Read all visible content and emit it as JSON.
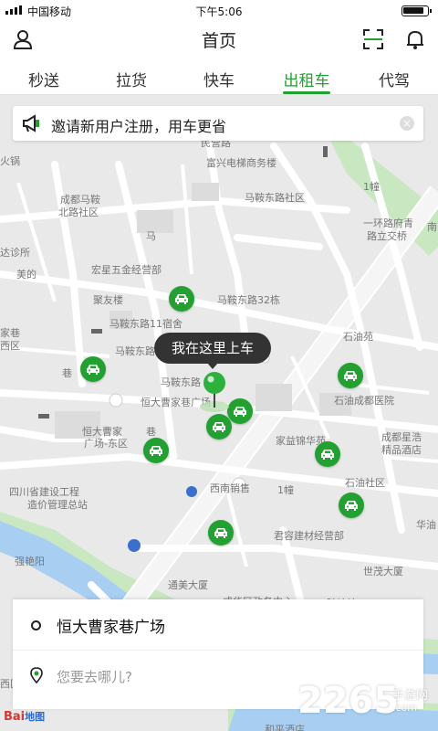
{
  "status_bar": {
    "carrier": "中国移动",
    "time": "下午5:06"
  },
  "header": {
    "title": "首页",
    "profile_icon": "person-icon",
    "scan_icon": "scan-icon",
    "bell_icon": "bell-icon"
  },
  "tabs": [
    {
      "label": "秒送"
    },
    {
      "label": "拉货"
    },
    {
      "label": "快车"
    },
    {
      "label": "出租车",
      "active": true
    },
    {
      "label": "代驾"
    }
  ],
  "banner": {
    "text": "邀请新用户注册，用车更省",
    "icon": "megaphone-icon",
    "close": "×"
  },
  "map": {
    "labels": [
      "民营路",
      "火锅",
      "富兴电梯商务楼",
      "成都马鞍",
      "北路社区",
      "马鞍东路社区",
      "1幢",
      "一环路府青",
      "路立交桥",
      "南",
      "达诊所",
      "宏星五金经营部",
      "美的",
      "马",
      "聚友楼",
      "马鞍东路32栋",
      "家巷",
      "西区",
      "马鞍东路11宿舍",
      "马鞍东路",
      "石油苑",
      "巷",
      "马鞍东路",
      "恒大曹家巷广场",
      "石油成都医院",
      "恒大曹家",
      "巷",
      "广场-东区",
      "家益锦华苑",
      "成都星浩",
      "精品酒店",
      "西南销售",
      "1幢",
      "石油社区",
      "四川省建设工程",
      "造价管理总站",
      "华油",
      "君容建材经营部",
      "世茂大厦",
      "强艳阳",
      "通美大厦",
      "成华区政务中心",
      "骑味坊",
      "西区",
      "和平酒店"
    ]
  },
  "callout": {
    "text": "我在这里上车"
  },
  "bottom_card": {
    "origin": "恒大曹家巷广场",
    "destination_placeholder": "您要去哪儿?"
  },
  "baidu_logo": {
    "text": "Bai",
    "map_word": "地图"
  },
  "watermark": {
    "number": "2265",
    "site_cn": "手游网",
    "domain": ".com"
  },
  "colors": {
    "accent_green": "#21a230",
    "callout_bg": "#333333"
  }
}
